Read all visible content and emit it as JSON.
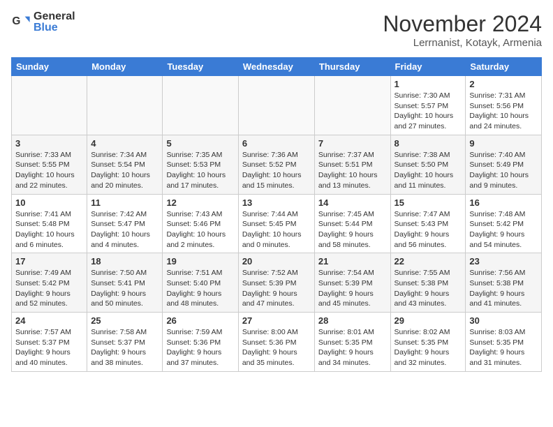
{
  "logo": {
    "general": "General",
    "blue": "Blue"
  },
  "title": "November 2024",
  "location": "Lerrnanist, Kotayk, Armenia",
  "days_of_week": [
    "Sunday",
    "Monday",
    "Tuesday",
    "Wednesday",
    "Thursday",
    "Friday",
    "Saturday"
  ],
  "weeks": [
    [
      {
        "day": "",
        "info": ""
      },
      {
        "day": "",
        "info": ""
      },
      {
        "day": "",
        "info": ""
      },
      {
        "day": "",
        "info": ""
      },
      {
        "day": "",
        "info": ""
      },
      {
        "day": "1",
        "info": "Sunrise: 7:30 AM\nSunset: 5:57 PM\nDaylight: 10 hours and 27 minutes."
      },
      {
        "day": "2",
        "info": "Sunrise: 7:31 AM\nSunset: 5:56 PM\nDaylight: 10 hours and 24 minutes."
      }
    ],
    [
      {
        "day": "3",
        "info": "Sunrise: 7:33 AM\nSunset: 5:55 PM\nDaylight: 10 hours and 22 minutes."
      },
      {
        "day": "4",
        "info": "Sunrise: 7:34 AM\nSunset: 5:54 PM\nDaylight: 10 hours and 20 minutes."
      },
      {
        "day": "5",
        "info": "Sunrise: 7:35 AM\nSunset: 5:53 PM\nDaylight: 10 hours and 17 minutes."
      },
      {
        "day": "6",
        "info": "Sunrise: 7:36 AM\nSunset: 5:52 PM\nDaylight: 10 hours and 15 minutes."
      },
      {
        "day": "7",
        "info": "Sunrise: 7:37 AM\nSunset: 5:51 PM\nDaylight: 10 hours and 13 minutes."
      },
      {
        "day": "8",
        "info": "Sunrise: 7:38 AM\nSunset: 5:50 PM\nDaylight: 10 hours and 11 minutes."
      },
      {
        "day": "9",
        "info": "Sunrise: 7:40 AM\nSunset: 5:49 PM\nDaylight: 10 hours and 9 minutes."
      }
    ],
    [
      {
        "day": "10",
        "info": "Sunrise: 7:41 AM\nSunset: 5:48 PM\nDaylight: 10 hours and 6 minutes."
      },
      {
        "day": "11",
        "info": "Sunrise: 7:42 AM\nSunset: 5:47 PM\nDaylight: 10 hours and 4 minutes."
      },
      {
        "day": "12",
        "info": "Sunrise: 7:43 AM\nSunset: 5:46 PM\nDaylight: 10 hours and 2 minutes."
      },
      {
        "day": "13",
        "info": "Sunrise: 7:44 AM\nSunset: 5:45 PM\nDaylight: 10 hours and 0 minutes."
      },
      {
        "day": "14",
        "info": "Sunrise: 7:45 AM\nSunset: 5:44 PM\nDaylight: 9 hours and 58 minutes."
      },
      {
        "day": "15",
        "info": "Sunrise: 7:47 AM\nSunset: 5:43 PM\nDaylight: 9 hours and 56 minutes."
      },
      {
        "day": "16",
        "info": "Sunrise: 7:48 AM\nSunset: 5:42 PM\nDaylight: 9 hours and 54 minutes."
      }
    ],
    [
      {
        "day": "17",
        "info": "Sunrise: 7:49 AM\nSunset: 5:42 PM\nDaylight: 9 hours and 52 minutes."
      },
      {
        "day": "18",
        "info": "Sunrise: 7:50 AM\nSunset: 5:41 PM\nDaylight: 9 hours and 50 minutes."
      },
      {
        "day": "19",
        "info": "Sunrise: 7:51 AM\nSunset: 5:40 PM\nDaylight: 9 hours and 48 minutes."
      },
      {
        "day": "20",
        "info": "Sunrise: 7:52 AM\nSunset: 5:39 PM\nDaylight: 9 hours and 47 minutes."
      },
      {
        "day": "21",
        "info": "Sunrise: 7:54 AM\nSunset: 5:39 PM\nDaylight: 9 hours and 45 minutes."
      },
      {
        "day": "22",
        "info": "Sunrise: 7:55 AM\nSunset: 5:38 PM\nDaylight: 9 hours and 43 minutes."
      },
      {
        "day": "23",
        "info": "Sunrise: 7:56 AM\nSunset: 5:38 PM\nDaylight: 9 hours and 41 minutes."
      }
    ],
    [
      {
        "day": "24",
        "info": "Sunrise: 7:57 AM\nSunset: 5:37 PM\nDaylight: 9 hours and 40 minutes."
      },
      {
        "day": "25",
        "info": "Sunrise: 7:58 AM\nSunset: 5:37 PM\nDaylight: 9 hours and 38 minutes."
      },
      {
        "day": "26",
        "info": "Sunrise: 7:59 AM\nSunset: 5:36 PM\nDaylight: 9 hours and 37 minutes."
      },
      {
        "day": "27",
        "info": "Sunrise: 8:00 AM\nSunset: 5:36 PM\nDaylight: 9 hours and 35 minutes."
      },
      {
        "day": "28",
        "info": "Sunrise: 8:01 AM\nSunset: 5:35 PM\nDaylight: 9 hours and 34 minutes."
      },
      {
        "day": "29",
        "info": "Sunrise: 8:02 AM\nSunset: 5:35 PM\nDaylight: 9 hours and 32 minutes."
      },
      {
        "day": "30",
        "info": "Sunrise: 8:03 AM\nSunset: 5:35 PM\nDaylight: 9 hours and 31 minutes."
      }
    ]
  ]
}
